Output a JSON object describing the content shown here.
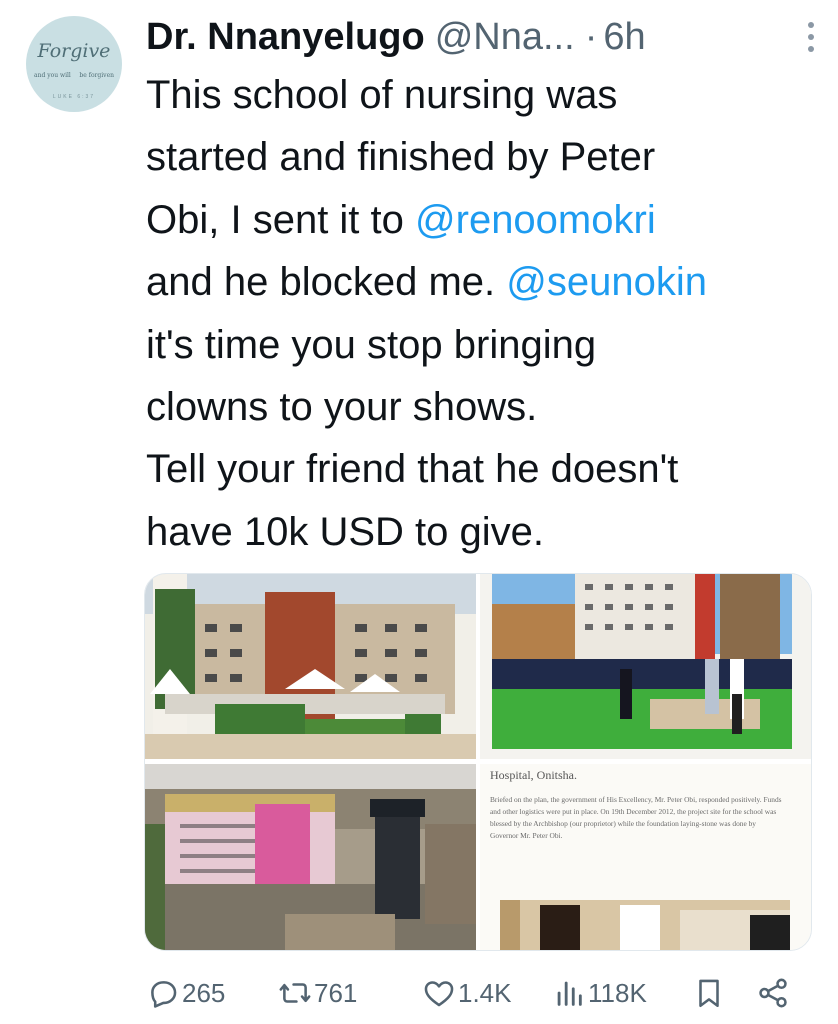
{
  "author": {
    "display_name": "Dr. Nnanyelugo",
    "handle": "@Nna...",
    "separator": "·",
    "time": "6h",
    "avatar": {
      "word": "Forgive",
      "left_text": "and you will",
      "right_text": "be forgiven",
      "bottom_text": "LUKE 6:37"
    }
  },
  "tweet": {
    "lines": [
      [
        {
          "t": "This school of nursing was"
        }
      ],
      [
        {
          "t": "started and finished by Peter"
        }
      ],
      [
        {
          "t": "Obi, I sent it to "
        },
        {
          "t": "@renoomokri",
          "mention": true
        }
      ],
      [
        {
          "t": "and he blocked me. "
        },
        {
          "t": "@seunokin",
          "mention": true
        }
      ],
      [
        {
          "t": "it's time you stop bringing"
        }
      ],
      [
        {
          "t": "clowns to your shows."
        }
      ],
      [
        {
          "t": "Tell your friend that he doesn't"
        }
      ],
      [
        {
          "t": "have 10k USD to give."
        }
      ]
    ]
  },
  "media": {
    "document": {
      "heading": "Hospital, Onitsha.",
      "body": "Briefed on the plan, the government of His Excellency, Mr. Peter Obi, responded positively. Funds and other logistics were put in place. On 19th December 2012, the project site for the school was blessed by the Archbishop (our proprietor) while the foundation laying-stone was done by Governor Mr. Peter Obi."
    }
  },
  "actions": {
    "replies": "265",
    "retweets": "761",
    "likes": "1.4K",
    "views": "118K"
  },
  "colors": {
    "accent": "#1d9bf0",
    "secondary_text": "#536471",
    "primary_text": "#0f1419"
  }
}
